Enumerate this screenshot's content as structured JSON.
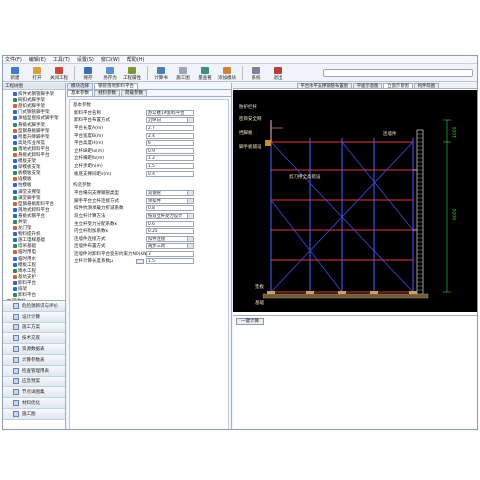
{
  "menu": [
    "文件(F)",
    "编辑(E)",
    "工具(T)",
    "设置(S)",
    "窗口(W)",
    "帮助(H)"
  ],
  "toolbar": [
    {
      "label": "新建",
      "color": "#3d7cc9"
    },
    {
      "label": "打开",
      "color": "#d9a23a"
    },
    {
      "label": "关闭工程",
      "color": "#c94a3d"
    },
    {
      "label": "保存",
      "color": "#3d6fb0"
    },
    {
      "label": "另存为",
      "color": "#5c8fd1"
    },
    {
      "label": "工程属性",
      "color": "#7a9a3c"
    },
    {
      "label": "计算书",
      "color": "#4b7db8"
    },
    {
      "label": "施工图",
      "color": "#9aa6b4"
    },
    {
      "label": "量查看",
      "color": "#3e8e7e"
    },
    {
      "label": "添加模块",
      "color": "#c9873d"
    },
    {
      "label": "系统",
      "color": "#7f7f9f"
    },
    {
      "label": "退出",
      "color": "#b83c3c"
    }
  ],
  "left_panel": {
    "title": "工程树图",
    "tree": [
      "扣件式钢管脚手架",
      "碗扣式脚手架",
      "盘扣式脚手架",
      "门式钢管脚手架",
      "承插型盘扣式脚手架",
      "悬挑式脚手架",
      "型钢悬挑脚手架",
      "附着升降脚手架",
      "高处作业吊篮",
      "落地式卸料平台",
      "悬挑式卸料平台",
      "模板支架",
      "梁模板支架",
      "板模板支架",
      "墙模板",
      "柱模板",
      "满堂支撑架",
      "满堂脚手架",
      "型钢悬挑卸料平台",
      "落地式卸料平台",
      "悬挑式钢平台",
      "井架",
      "龙门架",
      "物料提升机",
      "施工电梯基础",
      "塔吊基础",
      "临时用电",
      "临时用水",
      "模板工程",
      "降水工程",
      "基坑支护",
      "卸料平台",
      "排架",
      "卸料平台",
      "回收站"
    ],
    "nav": [
      "危险源辨识与评价",
      "设计计算",
      "施工方案",
      "技术交底",
      "资源数据表",
      "计算参数表",
      "检查管理用表",
      "应急预案",
      "节点详图集",
      "材料优化",
      "施工图"
    ]
  },
  "middle": {
    "tabs": [
      "模块选择",
      "钢管落地卸料平台"
    ],
    "sub_tabs": [
      "基本参数",
      "材料参数",
      "荷载参数"
    ],
    "section1": "基本参数",
    "rows1": [
      {
        "label": "卸料平台名称",
        "value": "办公楼1#卸料平台"
      },
      {
        "label": "卸料平台布置方式",
        "value": "沿纵向"
      },
      {
        "label": "平台长度A(m)",
        "value": "2.7"
      },
      {
        "label": "平台宽度B(m)",
        "value": "2.4"
      },
      {
        "label": "平台高度H(m)",
        "value": "6"
      },
      {
        "label": "立杆纵距la(m)",
        "value": "0.9"
      },
      {
        "label": "立杆横距lb(m)",
        "value": "1.2"
      },
      {
        "label": "立杆步距h(m)",
        "value": "1.5"
      },
      {
        "label": "板底支撑间距s(m)",
        "value": "0.4"
      }
    ],
    "section2": "构造参数",
    "rows2": [
      {
        "label": "平台横向支撑钢管类型",
        "value": "双钢管"
      },
      {
        "label": "脚手平台立杆连接方式",
        "value": "单扣件"
      },
      {
        "label": "扣件抗滑承载力折减系数",
        "value": "0.8"
      },
      {
        "label": "双立杆计算方法",
        "value": "按双立杆受力设计"
      },
      {
        "label": "主立杆受力分配系数κ",
        "value": "0.6"
      },
      {
        "label": "内立杆附加系数κ",
        "value": "0.25"
      },
      {
        "label": "连墙件连接方式",
        "value": "扣件连接"
      },
      {
        "label": "连墙件布置方式",
        "value": "两步三跨"
      },
      {
        "label": "连墙件对卸料平台变形约束力N0(kN)",
        "value": "3"
      },
      {
        "label": "立杆计算长度系数μ",
        "value": "1.5"
      }
    ]
  },
  "right": {
    "tabs": [
      "平台水平支撑钢管布置图",
      "平面示意图",
      "立面示意图",
      "构件简图"
    ],
    "active_tab": 2,
    "drawing_labels": {
      "top": "防护栏杆",
      "guard": "密目安全网",
      "toe": "挡脚板",
      "board": "脚手板铺设",
      "tie": "连墙件",
      "brace": "剪刀撑全高搭设",
      "pad": "垫板",
      "base": "基础",
      "dim_total": "6000",
      "dim_top": "1000"
    },
    "result_button": "一键计算"
  },
  "colors": {
    "drawing_bg": "#000000",
    "pole": "#3a4fe0",
    "ledger": "#e03a3a",
    "tie": "#f0a2b4",
    "text": "#f0e0c8",
    "dimension": "#39d24a"
  }
}
